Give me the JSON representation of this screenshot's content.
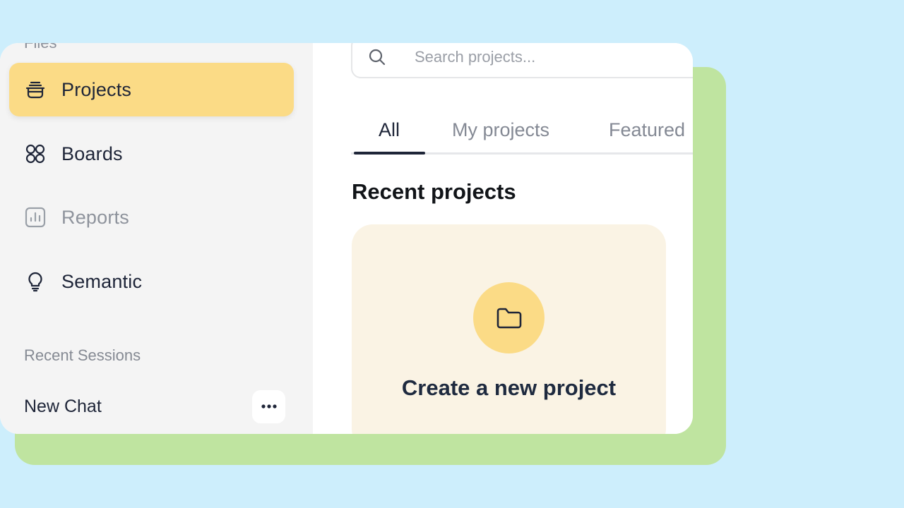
{
  "sidebar": {
    "heading_partial": "Files",
    "items": [
      {
        "label": "Projects",
        "icon": "bucket-icon",
        "active": true
      },
      {
        "label": "Boards",
        "icon": "grid-circles-icon",
        "active": false
      },
      {
        "label": "Reports",
        "icon": "bar-chart-icon",
        "active": false
      },
      {
        "label": "Semantic",
        "icon": "lightbulb-icon",
        "active": false
      }
    ],
    "recent_sessions_label": "Recent Sessions",
    "sessions": [
      {
        "label": "New Chat",
        "icon": "more-dots-icon"
      }
    ]
  },
  "search": {
    "placeholder": "Search projects...",
    "value": "",
    "icon": "search-icon"
  },
  "tabs": [
    {
      "label": "All",
      "active": true
    },
    {
      "label": "My projects",
      "active": false
    },
    {
      "label": "Featured",
      "active": false
    }
  ],
  "main": {
    "section_title": "Recent projects",
    "create_card": {
      "label": "Create a new project",
      "icon": "folder-icon"
    }
  },
  "colors": {
    "background": "#cdeefc",
    "back_card": "#bfe4a0",
    "accent": "#fbdb86",
    "sidebar_bg": "#f4f4f4",
    "card_bg": "#faf3e4",
    "text_dark": "#1e2538",
    "text_muted": "#8e939c"
  }
}
